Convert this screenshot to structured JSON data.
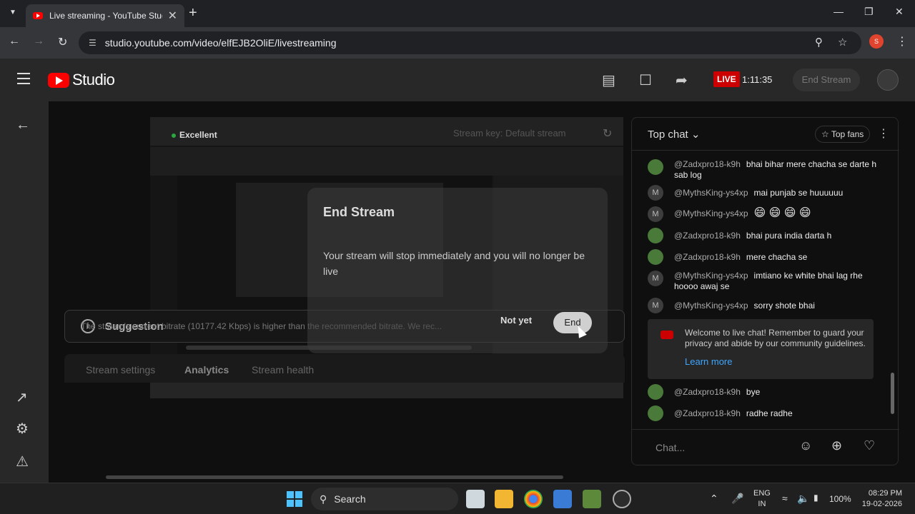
{
  "browser": {
    "tab_title": "Live streaming - YouTube Studio",
    "url": "studio.youtube.com/video/elfEJB2OliE/livestreaming",
    "profile_initial": "S"
  },
  "header": {
    "brand": "Studio",
    "live_label": "LIVE",
    "live_time": "1:11:35",
    "end_stream_label": "End Stream"
  },
  "preview": {
    "connection_status": "Excellent",
    "stream_key_label": "Stream key: Default stream"
  },
  "suggestion": {
    "title": "Suggestion",
    "message": "The stream's current bitrate (10177.42 Kbps) is higher than the recommended bitrate. We rec..."
  },
  "tabs": [
    "Stream settings",
    "Analytics",
    "Stream health"
  ],
  "modal": {
    "title": "End Stream",
    "body": "Your stream will stop immediately and you will no longer be live",
    "cancel_label": "Not yet",
    "confirm_label": "End"
  },
  "chat": {
    "title": "Top chat",
    "top_fans_label": "Top fans",
    "messages": [
      {
        "author": "@Zadxpro18-k9h",
        "text": "bhai bihar mere chacha se darte h sab log",
        "avatar": "g"
      },
      {
        "author": "@MythsKing-ys4xp",
        "text": "mai punjab se huuuuuu",
        "avatar": "M"
      },
      {
        "author": "@MythsKing-ys4xp",
        "text": "😄 😄 😄 😄",
        "avatar": "M"
      },
      {
        "author": "@Zadxpro18-k9h",
        "text": "bhai pura india darta h",
        "avatar": "g"
      },
      {
        "author": "@Zadxpro18-k9h",
        "text": "mere chacha se",
        "avatar": "g"
      },
      {
        "author": "@MythsKing-ys4xp",
        "text": "imtiano ke white bhai lag rhe hoooo awaj se",
        "avatar": "M"
      },
      {
        "author": "@MythsKing-ys4xp",
        "text": "sorry shote bhai",
        "avatar": "M"
      },
      {
        "author": "@Zadxpro18-k9h",
        "text": "bye",
        "avatar": "g"
      },
      {
        "author": "@Zadxpro18-k9h",
        "text": "radhe radhe",
        "avatar": "g"
      }
    ],
    "welcome_text": "Welcome to live chat! Remember to guard your privacy and abide by our community guidelines.",
    "learn_more_label": "Learn more",
    "input_placeholder": "Chat..."
  },
  "taskbar": {
    "search_label": "Search",
    "lang_line1": "ENG",
    "lang_line2": "IN",
    "battery": "100%",
    "time": "08:29 PM",
    "date": "19-02-2026"
  }
}
